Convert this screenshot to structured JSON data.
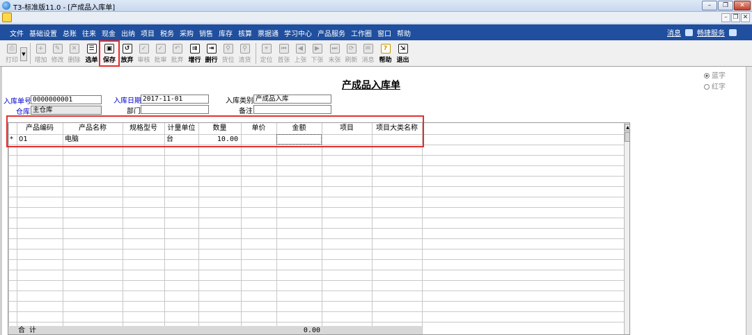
{
  "window": {
    "title": "T3-标准版11.0 - [产成品入库单]",
    "controls": {
      "minimize": "–",
      "restore": "❐",
      "close": "✕"
    }
  },
  "mdi": {
    "minimize": "–",
    "restore": "❐",
    "close": "✕"
  },
  "menu": {
    "items": [
      "文件",
      "基础设置",
      "总账",
      "往来",
      "现金",
      "出纳",
      "项目",
      "税务",
      "采购",
      "销售",
      "库存",
      "核算",
      "票据通",
      "学习中心",
      "产品服务",
      "工作圈",
      "窗口",
      "帮助"
    ],
    "right": {
      "news": "消息",
      "service": "畅捷服务"
    }
  },
  "toolbar": {
    "print": "打印",
    "add": "增加",
    "edit": "修改",
    "delete": "删除",
    "select": "选单",
    "save": "保存",
    "abandon": "放弃",
    "approve": "审核",
    "batch_approve": "批审",
    "batch_abandon": "批弃",
    "add_row": "增行",
    "delete_row": "删行",
    "locate_item": "货位",
    "clear_item": "清货",
    "position": "定位",
    "first": "首张",
    "prev": "上张",
    "next": "下张",
    "last": "末张",
    "refresh": "刷新",
    "message": "消息",
    "help": "帮助",
    "exit": "退出"
  },
  "form": {
    "title": "产成品入库单",
    "color_options": {
      "blue": "蓝字",
      "red": "红字"
    },
    "fields": {
      "doc_no_label": "入库单号",
      "doc_no": "0000000001",
      "date_label": "入库日期",
      "date": "2017-11-01",
      "type_label": "入库类别",
      "type": "产成品入库",
      "warehouse_label": "仓库",
      "warehouse": "主仓库",
      "dept_label": "部门",
      "dept": "",
      "remark_label": "备注",
      "remark": ""
    }
  },
  "grid": {
    "columns": [
      "产品编码",
      "产品名称",
      "规格型号",
      "计量单位",
      "数量",
      "单价",
      "金额",
      "项目",
      "项目大类名称"
    ],
    "rows": [
      {
        "marker": "*",
        "code": "01",
        "name": "电脑",
        "spec": "",
        "unit": "台",
        "qty": "10.00",
        "price": "",
        "amount": "",
        "project": "",
        "project_class": ""
      }
    ],
    "total_label": "合计",
    "total_amount": "0.00"
  }
}
